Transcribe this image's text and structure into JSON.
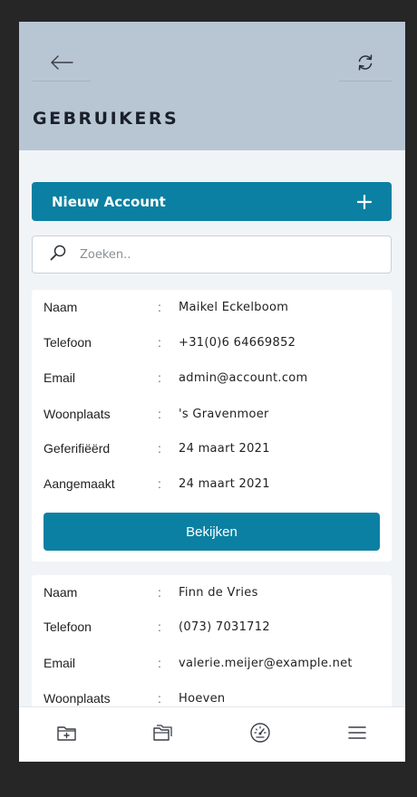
{
  "header": {
    "title": "GEBRUIKERS",
    "back_icon": "arrow-left-icon",
    "refresh_icon": "refresh-icon"
  },
  "new_account": {
    "label": "Nieuw Account",
    "icon": "plus-icon"
  },
  "search": {
    "placeholder": "Zoeken..",
    "value": "",
    "icon": "search-icon"
  },
  "users": [
    {
      "rows": [
        {
          "label": "Naam",
          "value": "Maikel Eckelboom"
        },
        {
          "label": "Telefoon",
          "value": "+31(0)6 64669852"
        },
        {
          "label": "Email",
          "value": "admin@account.com"
        },
        {
          "label": "Woonplaats",
          "value": "'s Gravenmoer"
        },
        {
          "label": "Geferifiëërd",
          "value": "24 maart 2021"
        },
        {
          "label": "Aangemaakt",
          "value": "24 maart 2021"
        }
      ],
      "button": "Bekijken"
    },
    {
      "rows": [
        {
          "label": "Naam",
          "value": "Finn de Vries"
        },
        {
          "label": "Telefoon",
          "value": "(073) 7031712"
        },
        {
          "label": "Email",
          "value": "valerie.meijer@example.net"
        },
        {
          "label": "Woonplaats",
          "value": "Hoeven"
        }
      ]
    }
  ],
  "separator": ":",
  "bottom_nav": [
    {
      "icon": "folder-add-icon"
    },
    {
      "icon": "folders-icon"
    },
    {
      "icon": "dashboard-gauge-icon"
    },
    {
      "icon": "menu-icon"
    }
  ],
  "colors": {
    "header_bg": "#b8c6d4",
    "accent": "#0b80a2",
    "page_bg": "#f1f4f7",
    "outer_bg": "#262626"
  }
}
